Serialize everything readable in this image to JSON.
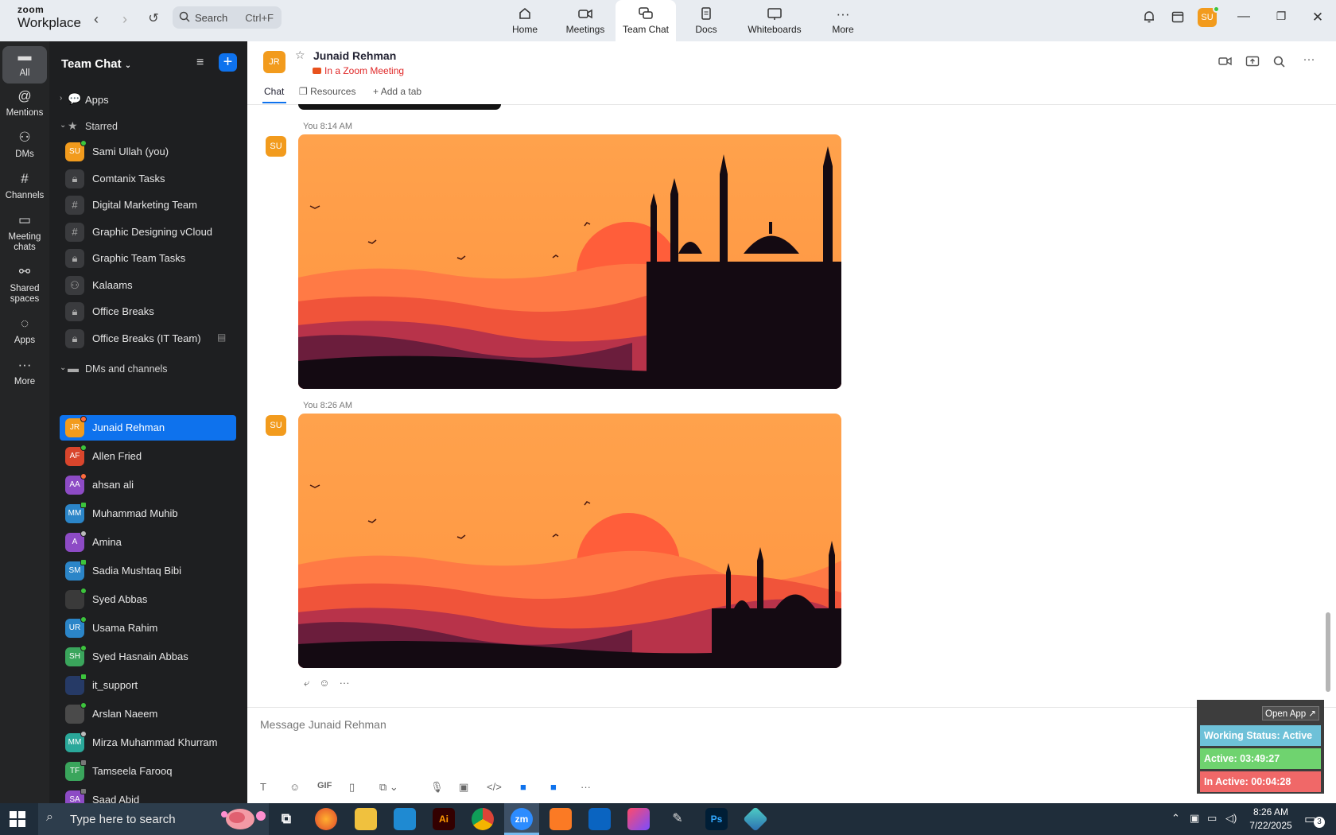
{
  "brand": {
    "line1": "zoom",
    "line2": "Workplace"
  },
  "search": {
    "label": "Search",
    "shortcut": "Ctrl+F"
  },
  "top_tabs": [
    {
      "label": "Home",
      "icon": "home-icon"
    },
    {
      "label": "Meetings",
      "icon": "video-camera-icon"
    },
    {
      "label": "Team Chat",
      "icon": "chat-bubbles-icon",
      "active": true
    },
    {
      "label": "Docs",
      "icon": "document-icon"
    },
    {
      "label": "Whiteboards",
      "icon": "whiteboard-icon"
    },
    {
      "label": "More",
      "icon": "more-dots-icon"
    }
  ],
  "user_avatar": "SU",
  "rail": [
    {
      "label": "All",
      "icon": "chat-bubble-icon",
      "active": true
    },
    {
      "label": "Mentions",
      "icon": "at-sign-icon"
    },
    {
      "label": "DMs",
      "icon": "people-icon"
    },
    {
      "label": "Channels",
      "icon": "hash-icon"
    },
    {
      "label": "Meeting chats",
      "line1": "Meeting",
      "line2": "chats",
      "icon": "calendar-icon"
    },
    {
      "label": "Shared spaces",
      "line1": "Shared",
      "line2": "spaces",
      "icon": "shared-spaces-icon"
    },
    {
      "label": "Apps",
      "icon": "apps-bubble-icon"
    },
    {
      "label": "More",
      "icon": "more-dots-icon"
    }
  ],
  "sidebar": {
    "title": "Team Chat",
    "apps_label": "Apps",
    "starred_label": "Starred",
    "starred": [
      {
        "name": "Sami Ullah (you)",
        "initials": "SU",
        "kind": "user",
        "color": "#f29b1d",
        "status": "online"
      },
      {
        "name": "Comtanix Tasks",
        "kind": "lock"
      },
      {
        "name": "Digital Marketing Team",
        "kind": "hash"
      },
      {
        "name": "Graphic Designing vCloud",
        "kind": "hash"
      },
      {
        "name": "Graphic Team Tasks",
        "kind": "lock"
      },
      {
        "name": "Kalaams",
        "kind": "group"
      },
      {
        "name": "Office Breaks",
        "kind": "lock"
      },
      {
        "name": "Office Breaks (IT Team)",
        "kind": "lock",
        "note": true
      }
    ],
    "dms_label": "DMs and channels",
    "dms": [
      {
        "name": "Junaid Rehman",
        "initials": "JR",
        "color": "#f29b1d",
        "status": "busy",
        "selected": true
      },
      {
        "name": "Allen Fried",
        "initials": "AF",
        "color": "#d9452c",
        "status": "online"
      },
      {
        "name": "ahsan ali",
        "initials": "AA",
        "color": "#8d4bc5",
        "status": "busy"
      },
      {
        "name": "Muhammad Muhib",
        "initials": "MM",
        "color": "#2b85c8",
        "status": "mobile"
      },
      {
        "name": "Amina",
        "initials": "A",
        "color": "#8d4bc5",
        "status": "away"
      },
      {
        "name": "Sadia Mushtaq Bibi",
        "initials": "SM",
        "color": "#2b85c8",
        "status": "mobile"
      },
      {
        "name": "Syed Abbas",
        "initials": "",
        "color": "#3a3a3a",
        "status": "online"
      },
      {
        "name": "Usama Rahim",
        "initials": "UR",
        "color": "#2b85c8",
        "status": "online"
      },
      {
        "name": "Syed Hasnain Abbas",
        "initials": "SH",
        "color": "#3aa55c",
        "status": "online"
      },
      {
        "name": "it_support",
        "initials": "",
        "color": "#263a66",
        "status": "mobile"
      },
      {
        "name": "Arslan Naeem",
        "initials": "",
        "color": "#4a4a4a",
        "status": "online"
      },
      {
        "name": "Mirza Muhammad Khurram",
        "initials": "MM",
        "color": "#2aa89a",
        "status": "away"
      },
      {
        "name": "Tamseela Farooq",
        "initials": "TF",
        "color": "#3aa55c",
        "status": "offline"
      },
      {
        "name": "Saad Abid",
        "initials": "SA",
        "color": "#8d4bc5",
        "status": "offline"
      }
    ]
  },
  "chat_header": {
    "initials": "JR",
    "name": "Junaid Rehman",
    "status": "In a Zoom Meeting",
    "tabs": [
      "Chat",
      "Resources",
      "Add a tab"
    ]
  },
  "messages": [
    {
      "avatar": "SU",
      "meta": "You 8:14 AM",
      "image": "orange sunset mosque silhouette"
    },
    {
      "avatar": "SU",
      "meta": "You 8:26 AM",
      "image": "orange sunset mosque silhouette"
    }
  ],
  "composer": {
    "placeholder": "Message Junaid Rehman",
    "gif_label": "GIF"
  },
  "widget": {
    "open_app": "Open App ↗",
    "working_status": "Working Status: Active",
    "active": "Active: 03:49:27",
    "inactive": "In Active: 00:04:28"
  },
  "taskbar": {
    "search_placeholder": "Type here to search",
    "time": "8:26 AM",
    "date": "7/22/2025",
    "notification_count": "3",
    "apps": [
      {
        "name": "task-view",
        "label": ""
      },
      {
        "name": "firefox",
        "label": ""
      },
      {
        "name": "file-explorer",
        "label": ""
      },
      {
        "name": "vscode",
        "label": ""
      },
      {
        "name": "illustrator",
        "label": "Ai"
      },
      {
        "name": "chrome",
        "label": ""
      },
      {
        "name": "zoom",
        "label": "zm"
      },
      {
        "name": "xampp",
        "label": ""
      },
      {
        "name": "outlook",
        "label": ""
      },
      {
        "name": "creative-cloud",
        "label": ""
      },
      {
        "name": "pen-tool",
        "label": ""
      },
      {
        "name": "photoshop",
        "label": "Ps"
      },
      {
        "name": "app-blue",
        "label": ""
      }
    ]
  }
}
